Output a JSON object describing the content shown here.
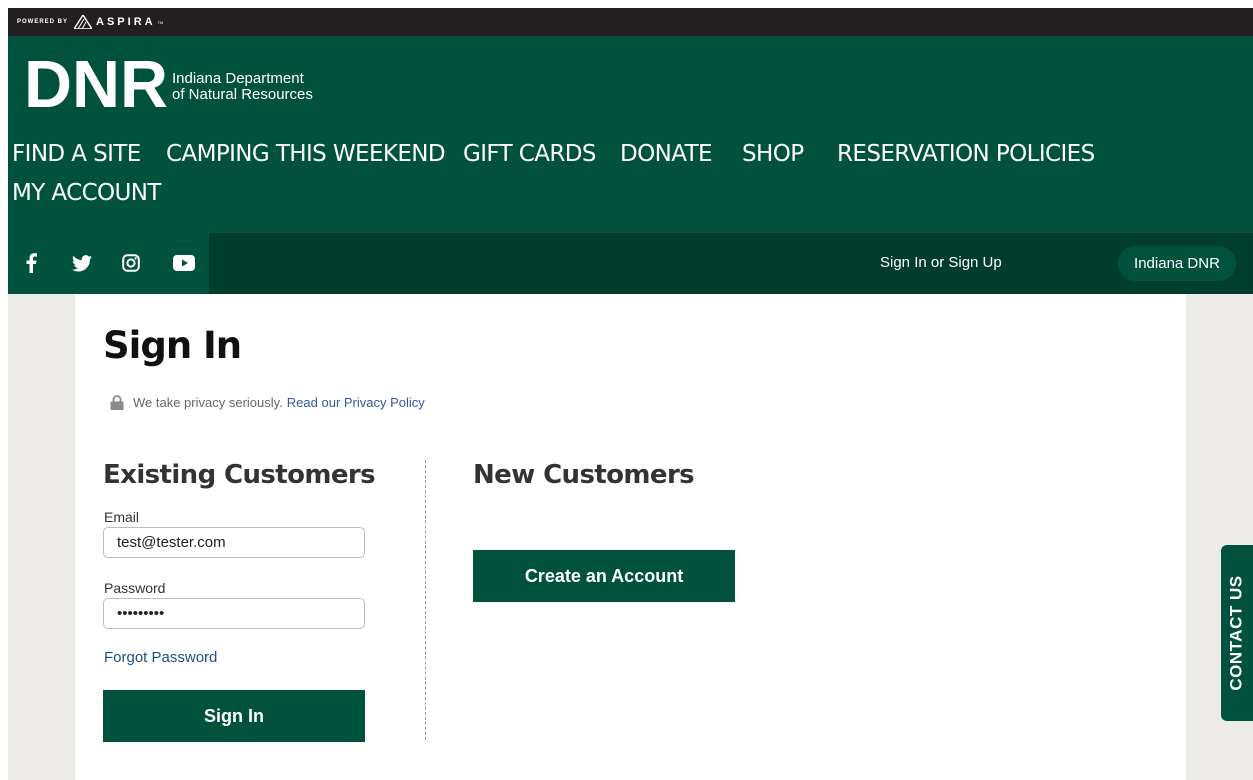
{
  "topbar": {
    "powered_by": "POWERED BY",
    "brand": "ASPIRA",
    "tm": "TM"
  },
  "logo": {
    "mark": "DNR",
    "line1": "Indiana Department",
    "line2": "of Natural Resources"
  },
  "nav": {
    "items": [
      "FIND A SITE",
      "CAMPING THIS WEEKEND",
      "GIFT CARDS",
      "DONATE",
      "SHOP",
      "RESERVATION POLICIES",
      "MY ACCOUNT"
    ]
  },
  "social": {
    "icons": [
      "facebook-icon",
      "twitter-icon",
      "instagram-icon",
      "youtube-icon"
    ]
  },
  "subbar": {
    "signin_link": "Sign In or Sign Up",
    "agency": "Indiana DNR"
  },
  "signin": {
    "title": "Sign In",
    "privacy_text": "We take privacy seriously.",
    "privacy_link": "Read our Privacy Policy"
  },
  "existing": {
    "heading": "Existing Customers",
    "email_label": "Email",
    "email_value": "test@tester.com",
    "password_label": "Password",
    "password_value": "123456789",
    "forgot": "Forgot Password",
    "signin_button": "Sign In"
  },
  "new_customers": {
    "heading": "New Customers",
    "create_button": "Create an Account"
  },
  "contact_tab": "CONTACT US",
  "colors": {
    "primary_green": "#00523c",
    "dark_green": "#003d2c",
    "topbar": "#231f20",
    "link_blue": "#2f5a9c"
  }
}
